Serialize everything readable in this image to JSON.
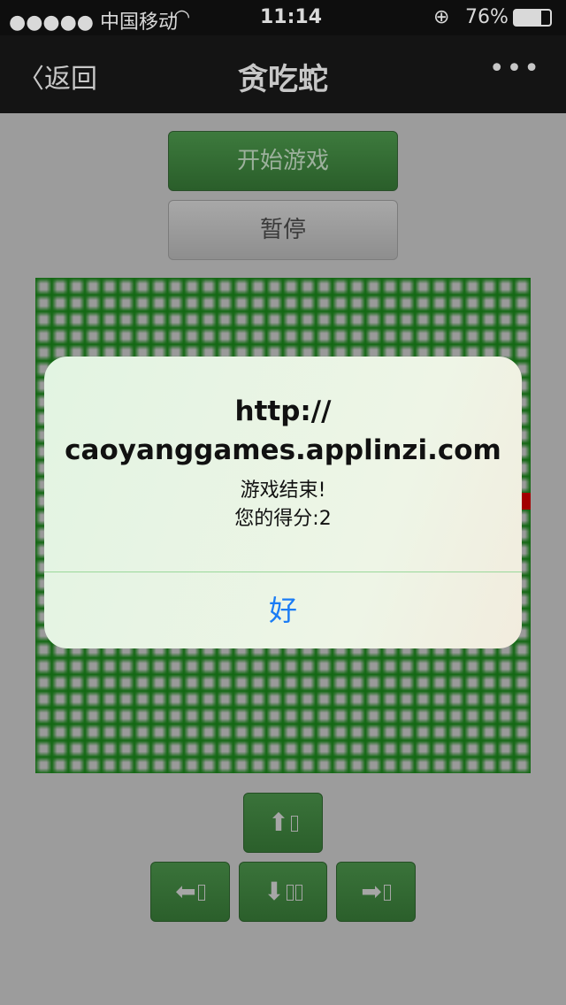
{
  "status": {
    "carrier": "●●●●● 中国移动",
    "wifi_icon": "wifi-icon",
    "time": "11:14",
    "battery": "76%"
  },
  "nav": {
    "back": "返回",
    "title": "贪吃蛇",
    "more": "•••"
  },
  "buttons": {
    "start": "开始游戏",
    "pause": "暂停"
  },
  "board": {
    "grid_cells": 30,
    "food_color": "#a30000"
  },
  "dialog": {
    "title_line1": "http://",
    "title_line2": "caoyanggames.applinzi.com",
    "message_line1": "游戏结束!",
    "message_line2": "您的得分:2",
    "ok": "好"
  },
  "controls": {
    "up": "⬆",
    "left": "⬅",
    "down": "⬇",
    "right": "➡"
  }
}
